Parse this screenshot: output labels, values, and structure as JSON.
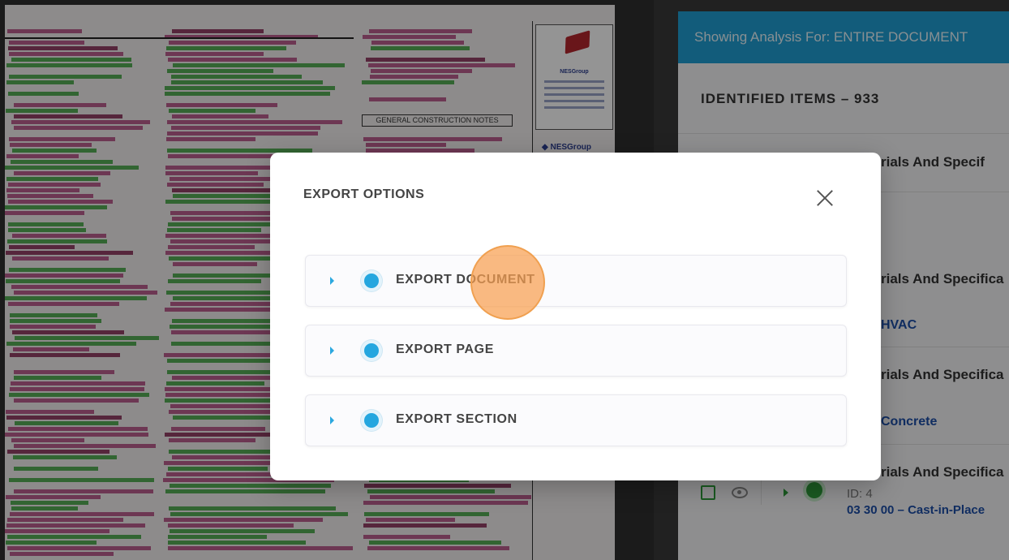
{
  "document": {
    "sheet_heading": "GENERAL CONSTRUCTION NOTES",
    "firm_logo_text": "NESGroup",
    "firm_small_logo_text": "NESGroup"
  },
  "panel": {
    "banner": "Showing Analysis For: ENTIRE DOCUMENT",
    "identified_items": "IDENTIFIED ITEMS – 933",
    "items": [
      {
        "title": "rials And Specif"
      },
      {
        "title": "rials And Specifica",
        "subtitle": "HVAC"
      },
      {
        "title": "rials And Specifica",
        "subtitle": "Concrete"
      },
      {
        "title": "rials And Specifica",
        "id": "ID: 4",
        "code": "03 30 00 – Cast-in-Place"
      }
    ]
  },
  "modal": {
    "title": "EXPORT OPTIONS",
    "options": [
      "EXPORT DOCUMENT",
      "EXPORT PAGE",
      "EXPORT SECTION"
    ]
  },
  "colors": {
    "banner": "#1f9fd4",
    "radio": "#24a6df",
    "status_green": "#2e9b3a",
    "link_blue": "#1d4ea8",
    "click_marker": "#f8a050"
  },
  "icons": [
    "close-icon",
    "expand-caret-icon",
    "radio-selected-icon",
    "checkbox-icon",
    "eye-icon",
    "status-dot-icon"
  ]
}
